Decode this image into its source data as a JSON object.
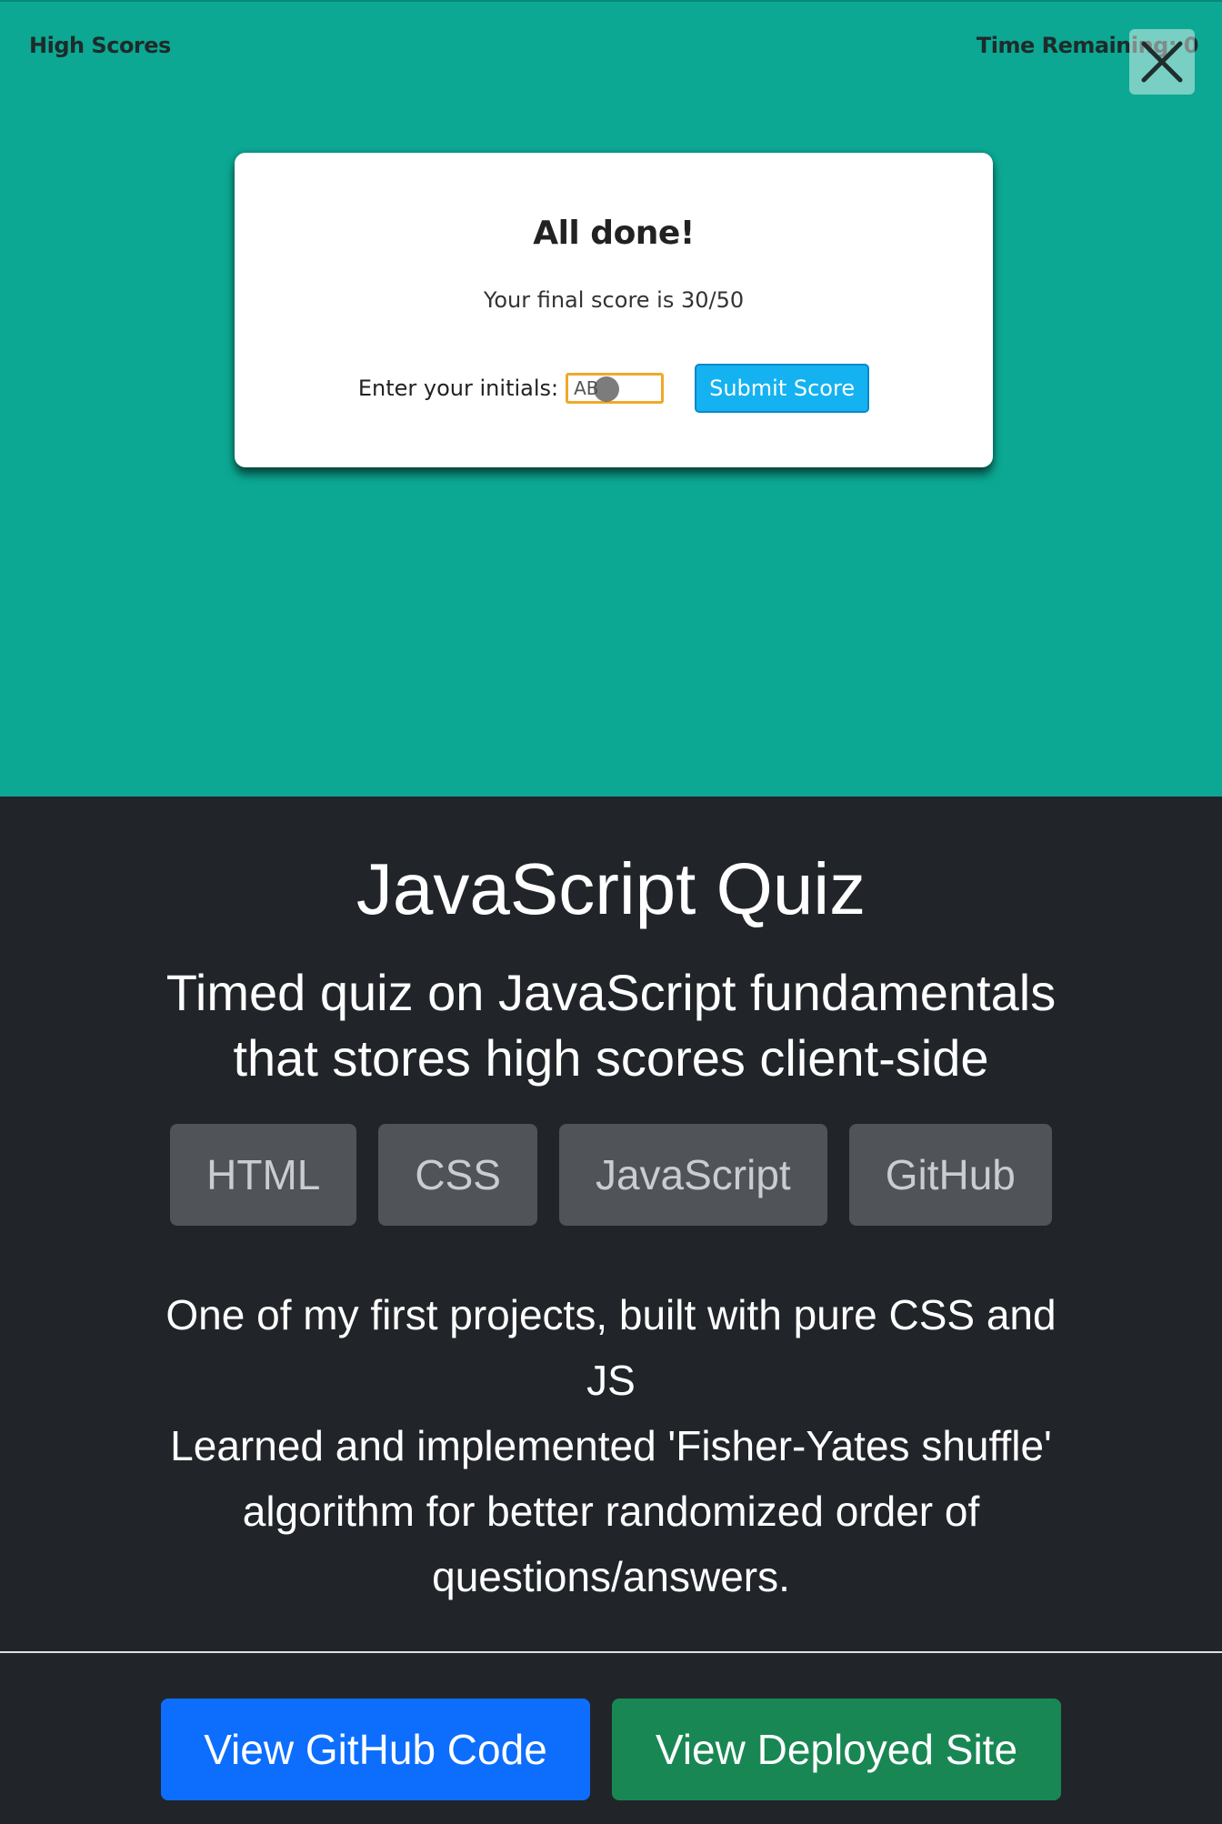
{
  "preview": {
    "high_scores_link": "High Scores",
    "timer_text": "Time Remaining: 0",
    "card": {
      "title": "All done!",
      "score_text": "Your final score is 30/50",
      "initials_label": "Enter your initials:",
      "initials_value": "AB",
      "submit_label": "Submit Score"
    }
  },
  "modal": {
    "close_icon": "close-icon",
    "title": "JavaScript Quiz",
    "subtitle": "Timed quiz on JavaScript fundamentals that stores high scores client-side",
    "tags": [
      "HTML",
      "CSS",
      "JavaScript",
      "GitHub"
    ],
    "description_line1": "One of my first projects, built with pure CSS and JS",
    "description_line2": "Learned and implemented 'Fisher-Yates shuffle' algorithm for better randomized order of questions/answers.",
    "buttons": {
      "github": "View GitHub Code",
      "site": "View Deployed Site"
    }
  },
  "colors": {
    "preview_bg": "#0ca893",
    "modal_bg": "#212529",
    "tag_bg": "#505459",
    "github_btn": "#0d6efd",
    "site_btn": "#198754",
    "submit_btn": "#14b2f0"
  }
}
